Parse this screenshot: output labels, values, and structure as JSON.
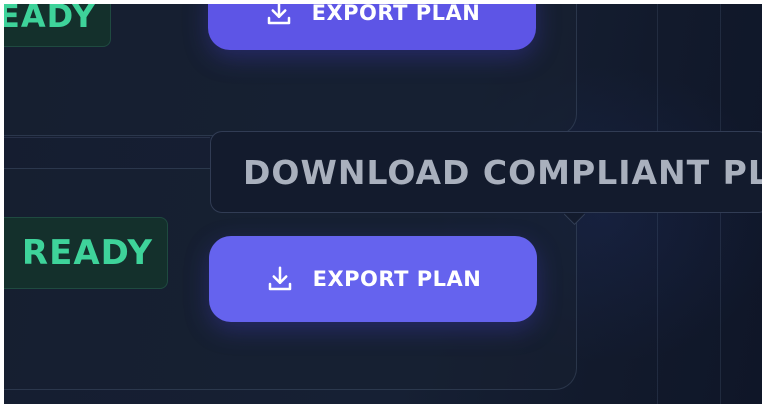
{
  "cards": [
    {
      "status": "READY",
      "export_label": "EXPORT PLAN",
      "export_icon": "download-icon"
    },
    {
      "status": "READY",
      "export_label": "EXPORT PLAN",
      "export_icon": "download-icon"
    }
  ],
  "tooltip": {
    "text": "DOWNLOAD COMPLIANT PL"
  },
  "colors": {
    "background": "#151d30",
    "button_primary": "#5d55e6",
    "status_ready_text": "#3ed39a",
    "status_ready_bg": "#14302c",
    "tooltip_bg": "#131b2d",
    "tooltip_text": "#a9b0bd"
  }
}
